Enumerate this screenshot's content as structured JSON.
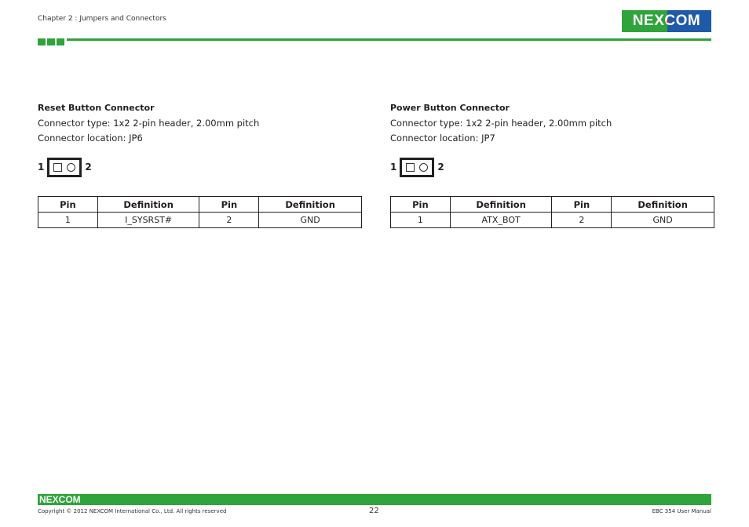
{
  "header": {
    "chapter": "Chapter 2 : Jumpers and Connectors",
    "logo_text": "NEXCOM",
    "brand_colors": {
      "green": "#2ea43a",
      "blue": "#1e5aa8",
      "red": "#e21b23"
    }
  },
  "sections": [
    {
      "title": "Reset Button Connector",
      "type_line": "Connector type: 1x2 2-pin header, 2.00mm pitch",
      "location_line": "Connector location: JP6",
      "pin_labels": {
        "left": "1",
        "right": "2"
      },
      "table": {
        "headers": [
          "Pin",
          "Definition",
          "Pin",
          "Definition"
        ],
        "rows": [
          [
            "1",
            "I_SYSRST#",
            "2",
            "GND"
          ]
        ]
      }
    },
    {
      "title": "Power Button Connector",
      "type_line": "Connector type: 1x2 2-pin header, 2.00mm pitch",
      "location_line": "Connector location: JP7",
      "pin_labels": {
        "left": "1",
        "right": "2"
      },
      "table": {
        "headers": [
          "Pin",
          "Definition",
          "Pin",
          "Definition"
        ],
        "rows": [
          [
            "1",
            "ATX_BOT",
            "2",
            "GND"
          ]
        ]
      }
    }
  ],
  "footer": {
    "logo_text": "NEXCOM",
    "copyright": "Copyright © 2012 NEXCOM International Co., Ltd. All rights reserved",
    "page_number": "22",
    "manual_title": "EBC 354 User Manual"
  }
}
